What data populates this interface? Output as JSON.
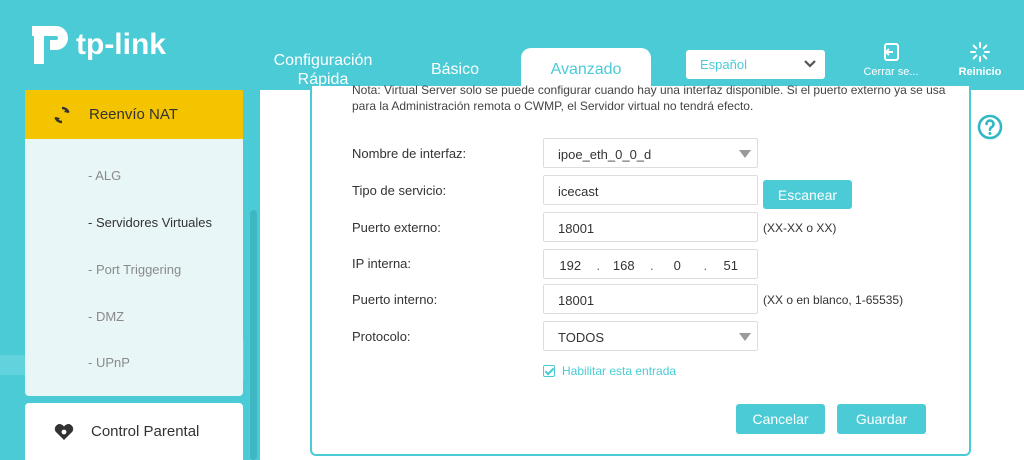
{
  "brand": {
    "name": "tp-link"
  },
  "nav": {
    "quick_setup_line1": "Configuración",
    "quick_setup_line2": "Rápida",
    "basic": "Básico",
    "advanced": "Avanzado"
  },
  "language": {
    "selected": "Español"
  },
  "header_actions": {
    "logout": "Cerrar se...",
    "reboot": "Reinicio"
  },
  "sidebar": {
    "section": "Reenvío NAT",
    "items": [
      "- ALG",
      "- Servidores Virtuales",
      "- Port Triggering",
      "- DMZ",
      "- UPnP"
    ],
    "active_item": "- Servidores Virtuales",
    "next_section": "Control Parental"
  },
  "form": {
    "note": "Nota: Virtual Server solo se puede configurar cuando hay una interfaz disponible. Si el puerto externo ya se usa para la Administración remota o CWMP, el Servidor virtual no tendrá efecto.",
    "interface_label": "Nombre de interfaz:",
    "interface_value": "ipoe_eth_0_0_d",
    "service_label": "Tipo de servicio:",
    "service_value": "icecast",
    "scan_button": "Escanear",
    "ext_port_label": "Puerto externo:",
    "ext_port_value": "18001",
    "ext_port_hint": "(XX-XX o XX)",
    "ip_label": "IP interna:",
    "ip_octets": [
      "192",
      "168",
      "0",
      "51"
    ],
    "int_port_label": "Puerto interno:",
    "int_port_value": "18001",
    "int_port_hint": "(XX o en blanco, 1-65535)",
    "protocol_label": "Protocolo:",
    "protocol_value": "TODOS",
    "enable_label": "Habilitar esta entrada",
    "enable_checked": true,
    "cancel_button": "Cancelar",
    "save_button": "Guardar"
  },
  "colors": {
    "accent": "#4acbd6",
    "active_section": "#f5c400"
  },
  "icons": {
    "logo": "tp-link-logo-icon",
    "logout": "logout-icon",
    "reboot": "reboot-icon",
    "nat": "nat-forwarding-icon",
    "parental": "parental-control-icon",
    "help": "help-icon"
  }
}
